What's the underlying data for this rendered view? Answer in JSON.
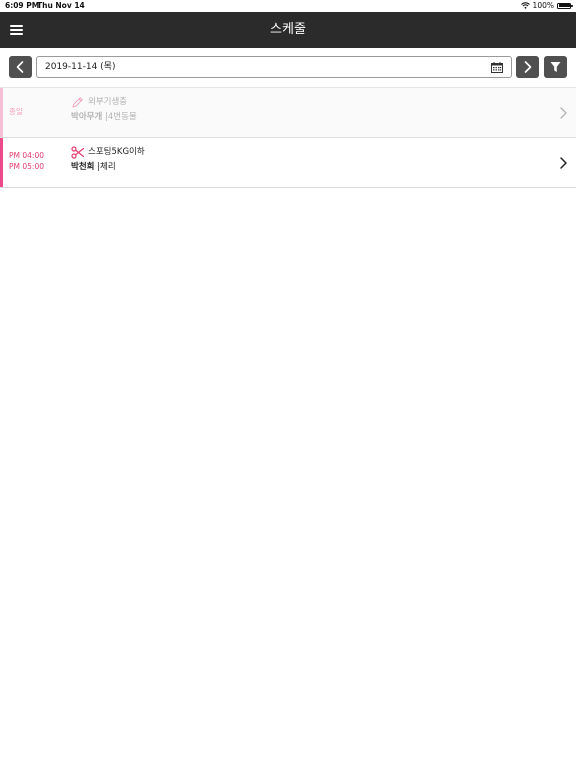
{
  "status_bar": {
    "time": "6:09 PM",
    "date": "Thu Nov 14",
    "battery": "100%"
  },
  "nav": {
    "title": "스케줄"
  },
  "date_bar": {
    "date_text": "2019-11-14  (목)"
  },
  "schedule": [
    {
      "time_lines": [
        "종일"
      ],
      "icon": "pencil-icon",
      "title": "외부기생충",
      "person": "박아무개",
      "separator": "|",
      "pet": "4번동물",
      "state": "dim"
    },
    {
      "time_lines": [
        "PM 04:00",
        "PM 05:00"
      ],
      "icon": "scissors-icon",
      "title": "스포팅5KG이하",
      "person": "박천희",
      "separator": "|",
      "pet": "체리",
      "state": "active"
    }
  ],
  "colors": {
    "nav_bg": "#2b2b2b",
    "accent": "#ec4a8b",
    "button_bg": "#505050"
  }
}
